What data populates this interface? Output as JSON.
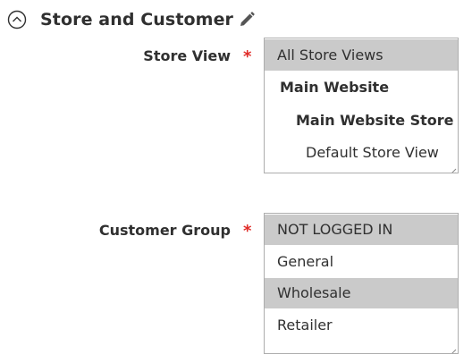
{
  "section": {
    "title": "Store and Customer",
    "collapse_icon": "circle-chevron-up-icon",
    "edit_icon": "pencil-icon"
  },
  "store_view": {
    "label": "Store View",
    "required_mark": "*",
    "options": [
      {
        "label": "All Store Views",
        "selected": true,
        "bold": false,
        "level": 0
      },
      {
        "label": "Main Website",
        "selected": false,
        "bold": true,
        "level": 1
      },
      {
        "label": "Main Website Store",
        "selected": false,
        "bold": true,
        "level": 2
      },
      {
        "label": "Default Store View",
        "selected": false,
        "bold": false,
        "level": 3
      }
    ]
  },
  "customer_group": {
    "label": "Customer Group",
    "required_mark": "*",
    "options": [
      {
        "label": "NOT LOGGED IN",
        "selected": true
      },
      {
        "label": "General",
        "selected": false
      },
      {
        "label": "Wholesale",
        "selected": true
      },
      {
        "label": "Retailer",
        "selected": false
      }
    ]
  },
  "colors": {
    "required": "#e02b27",
    "selected_option_bg": "#cacaca",
    "border": "#adadad",
    "text": "#303030"
  }
}
